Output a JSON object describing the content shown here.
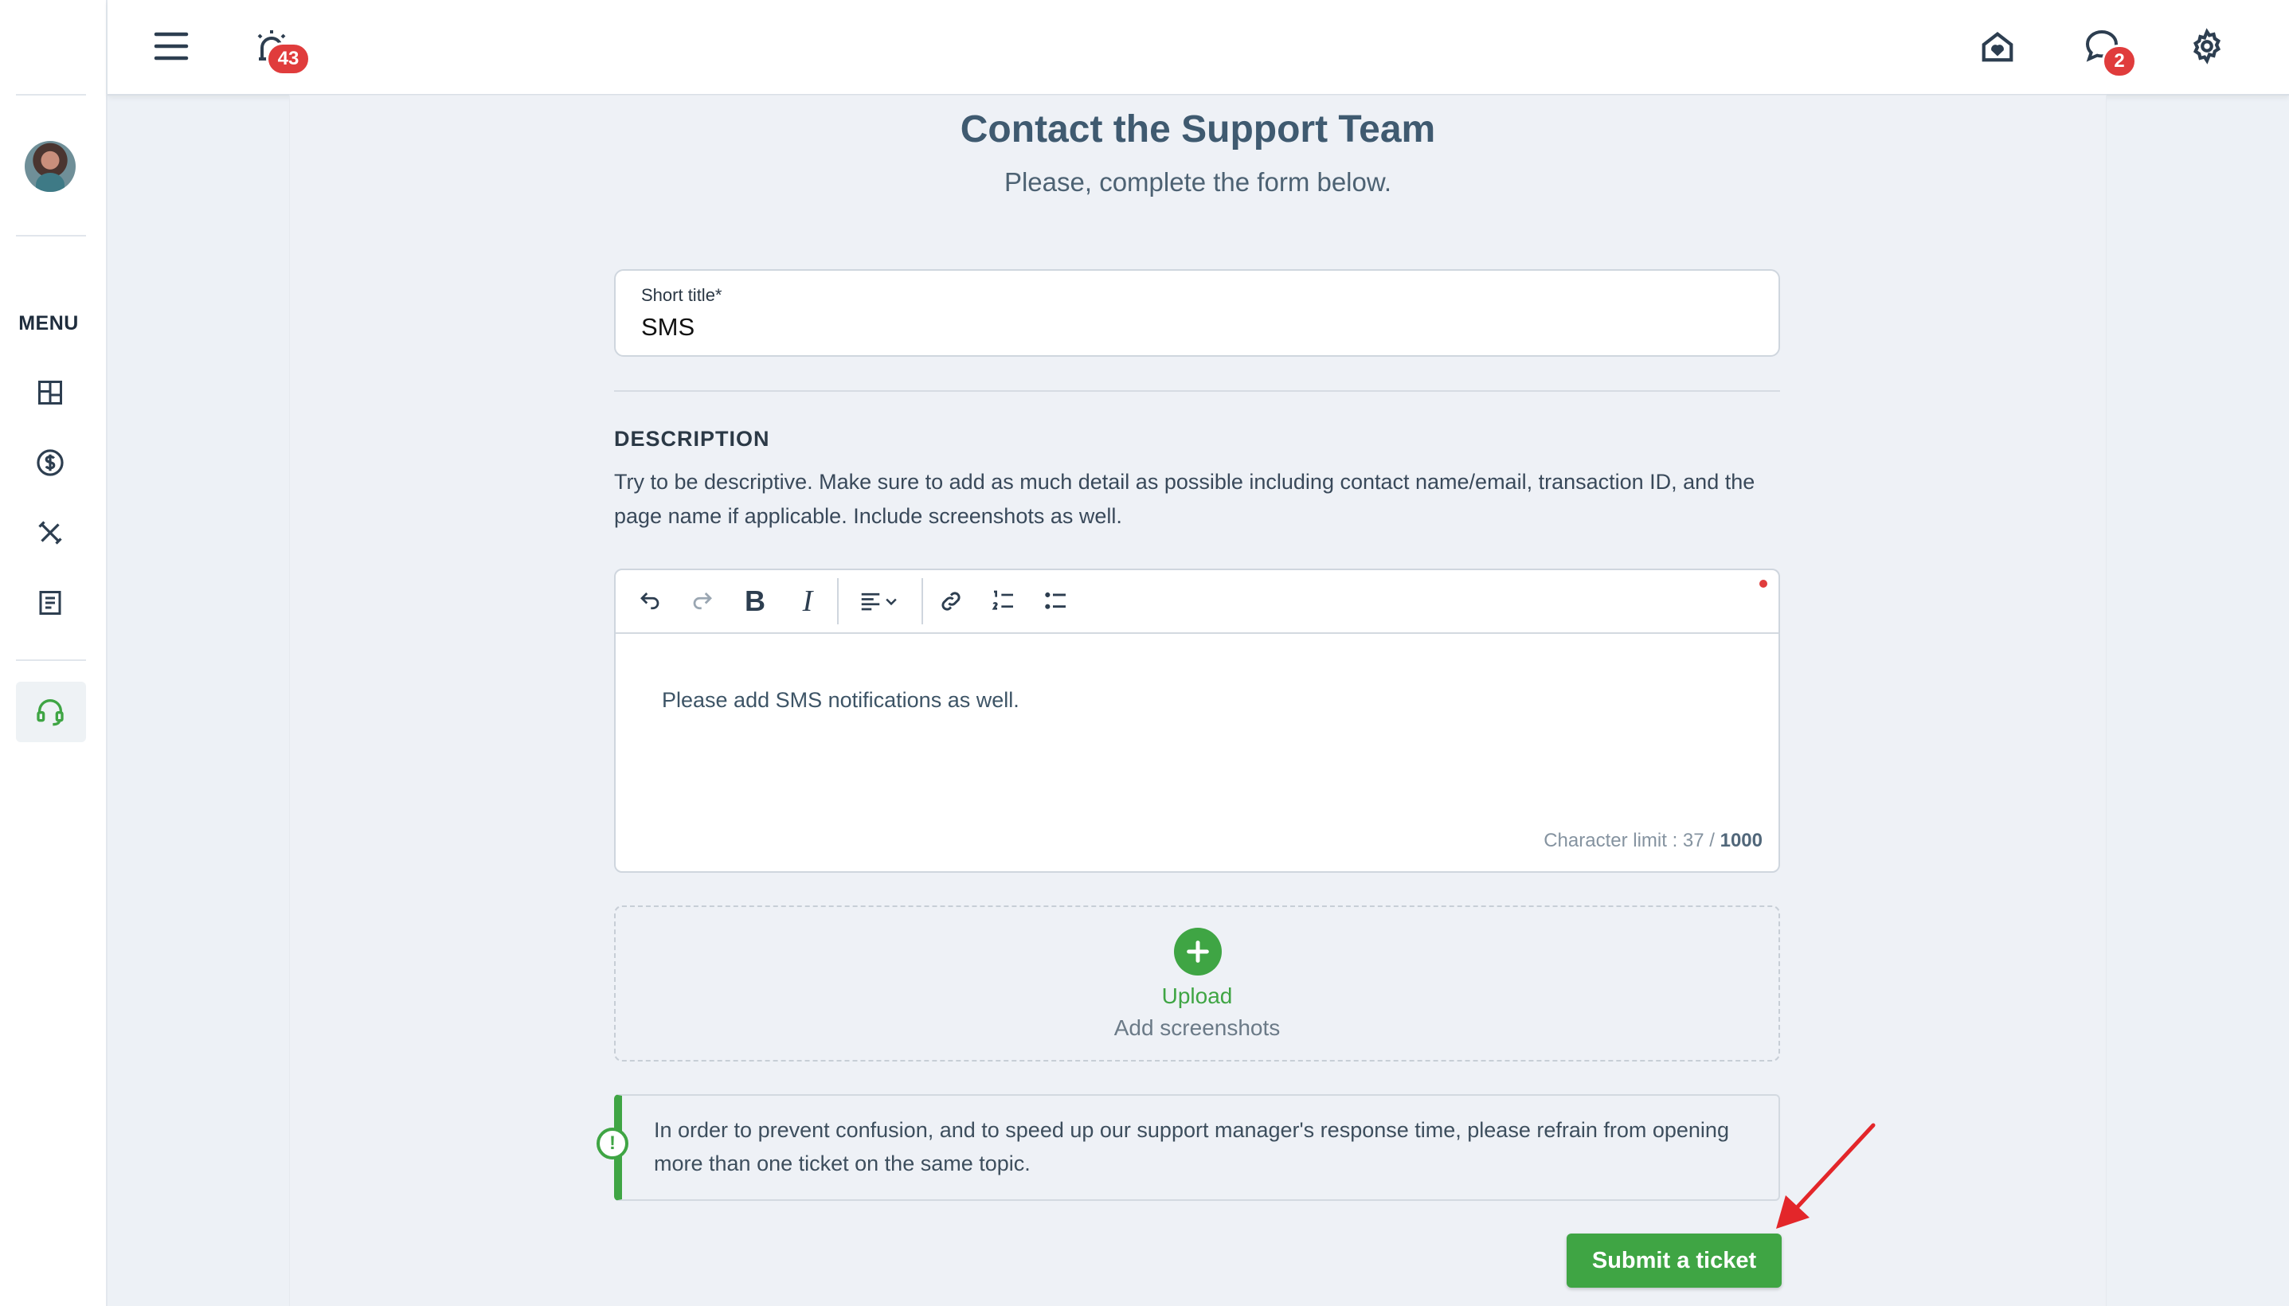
{
  "topbar": {
    "menu_icon": "hamburger-icon",
    "alarm_badge": "43",
    "chat_badge": "2",
    "home_icon": "home-heart-icon",
    "chat_icon": "chat-bubble-icon",
    "settings_icon": "gear-icon"
  },
  "sidebar": {
    "menu_label": "MENU",
    "items": [
      {
        "icon": "dashboard-icon"
      },
      {
        "icon": "dollar-circle-icon"
      },
      {
        "icon": "tools-icon"
      },
      {
        "icon": "document-icon"
      },
      {
        "icon": "headset-icon",
        "active": true
      }
    ]
  },
  "page": {
    "title": "Contact the Support Team",
    "subtitle": "Please, complete the form below."
  },
  "form": {
    "short_title_label": "Short title*",
    "short_title_value": "SMS",
    "description_heading": "DESCRIPTION",
    "description_help": "Try to be descriptive. Make sure to add as much detail as possible including contact name/email, transaction ID, and the page name if applicable. Include screenshots as well.",
    "editor_text": "Please add SMS notifications as well.",
    "char_limit_prefix": "Character limit : 37 / ",
    "char_limit_max": "1000",
    "upload_label": "Upload",
    "upload_sub": "Add screenshots",
    "notice": "In order to prevent confusion, and to speed up our support manager's response time, please refrain from opening more than one ticket on the same topic.",
    "notice_icon_glyph": "!",
    "submit_label": "Submit a ticket"
  },
  "colors": {
    "accent_green": "#3fa544",
    "badge_red": "#e03c3c",
    "title_blue": "#3f5a70"
  }
}
